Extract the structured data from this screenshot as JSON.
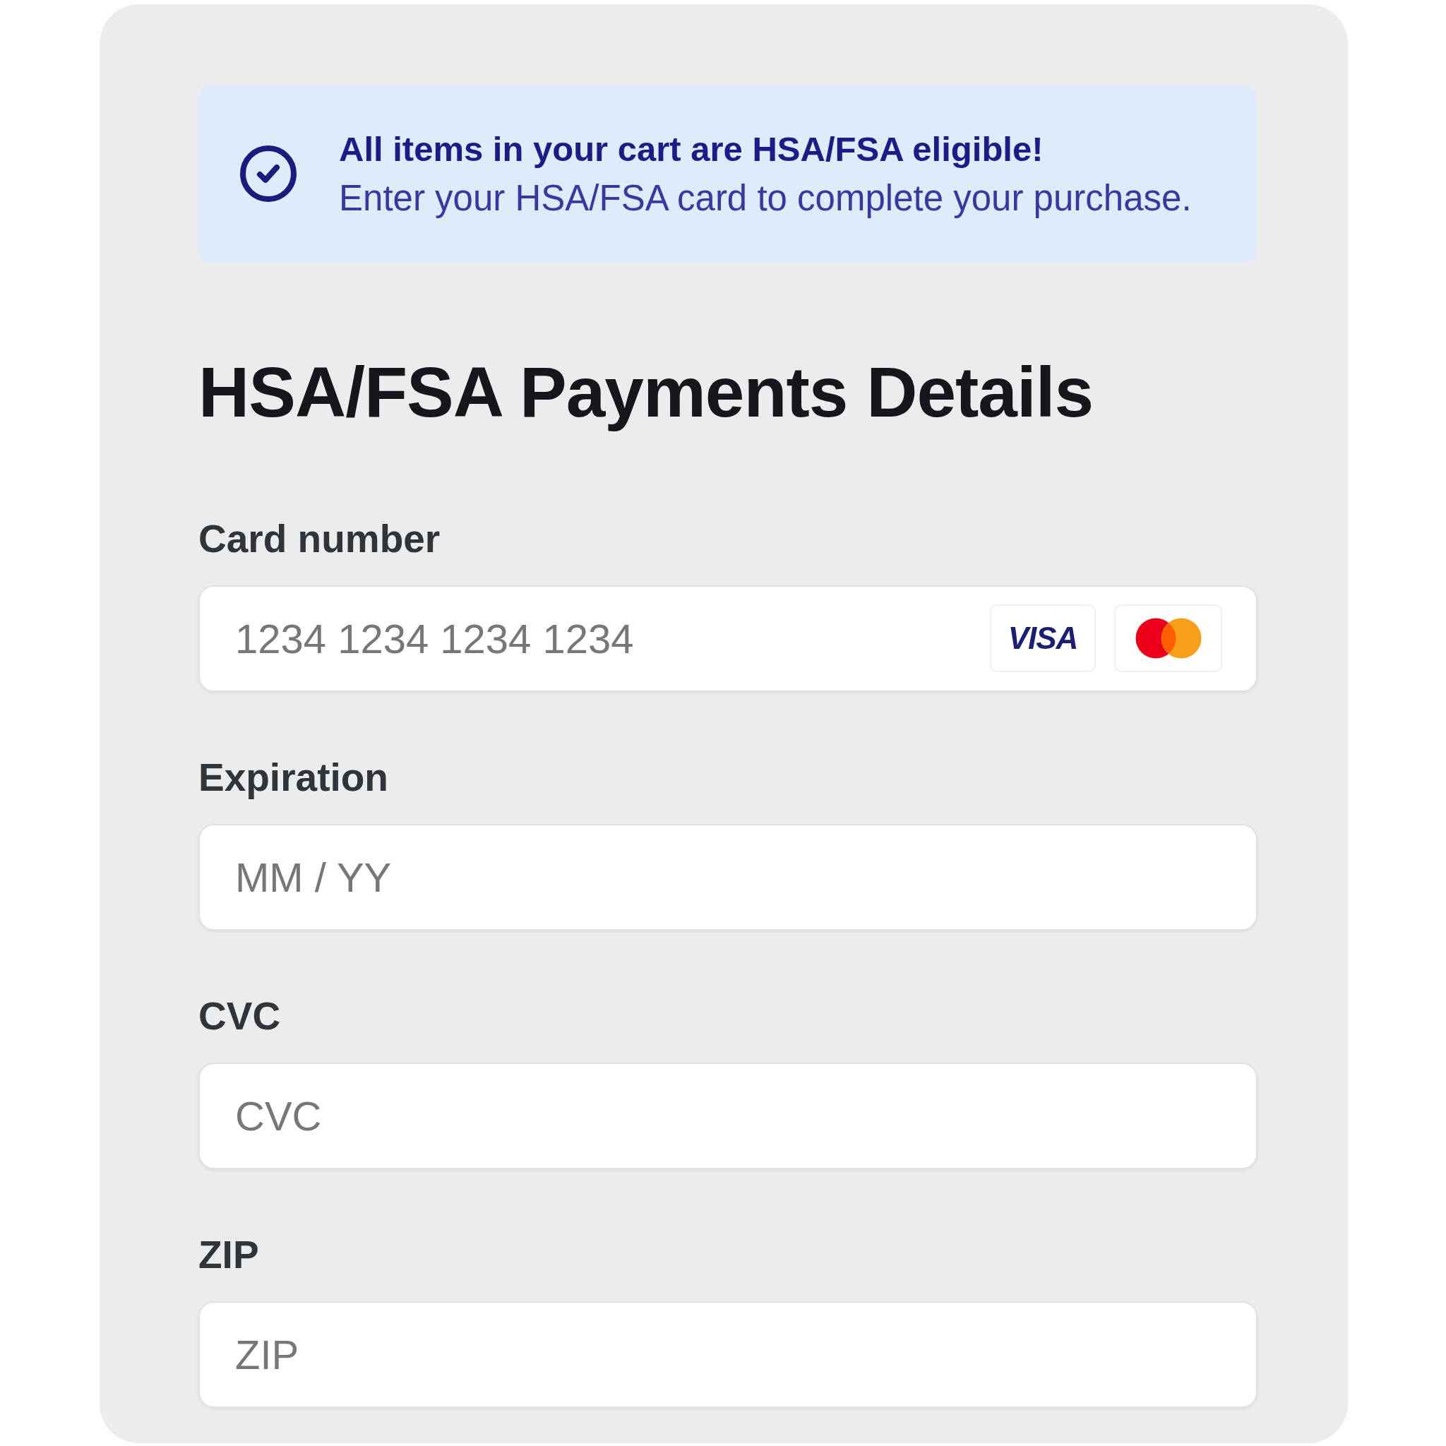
{
  "banner": {
    "title": "All items in your cart are HSA/FSA eligible!",
    "message": "Enter your HSA/FSA card to complete your purchase."
  },
  "heading": "HSA/FSA Payments Details",
  "fields": [
    {
      "label": "Card number",
      "placeholder": "1234 1234 1234 1234",
      "card_brands": [
        {
          "kind": "visa",
          "label": "VISA"
        },
        {
          "kind": "mastercard"
        }
      ]
    },
    {
      "label": "Expiration",
      "placeholder": "MM / YY"
    },
    {
      "label": "CVC",
      "placeholder": "CVC"
    },
    {
      "label": "ZIP",
      "placeholder": "ZIP"
    }
  ]
}
